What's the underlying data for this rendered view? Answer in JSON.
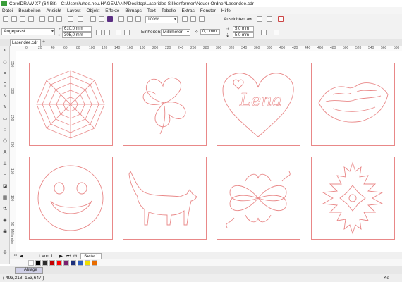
{
  "app": {
    "title": "CorelDRAW X7 (64 Bit) - C:\\Users\\uhde.neu.HAGEMANN\\Desktop\\Laseridee Silikonformen\\Neuer Ordner\\Laseridee.cdr"
  },
  "menu": [
    "Datei",
    "Bearbeiten",
    "Ansicht",
    "Layout",
    "Objekt",
    "Effekte",
    "Bitmaps",
    "Text",
    "Tabelle",
    "Extras",
    "Fenster",
    "Hilfe"
  ],
  "std_toolbar": {
    "zoom": "100%",
    "snap": "Ausrichten an"
  },
  "property_bar": {
    "page_size": "Angepasst",
    "width": "610,0 mm",
    "height": "305,0 mm",
    "units_label": "Einheiten:",
    "units": "Millimeter",
    "nudge": "0,1 mm",
    "dup_x": "5,0 mm",
    "dup_y": "5,0 mm"
  },
  "document_tab": {
    "name": "Laseridee.cdr",
    "add": "+"
  },
  "rulers": {
    "top": [
      "0",
      "20",
      "40",
      "60",
      "80",
      "100",
      "120",
      "140",
      "160",
      "180",
      "200",
      "220",
      "240",
      "260",
      "280",
      "300",
      "320",
      "340",
      "360",
      "380",
      "400",
      "420",
      "440",
      "460",
      "480",
      "500",
      "520",
      "540",
      "560",
      "580",
      "600"
    ],
    "left": [
      "350",
      "300",
      "250",
      "200",
      "150",
      "100",
      "50"
    ],
    "unit_label": "Millimeter"
  },
  "designs": [
    {
      "id": "spider-web"
    },
    {
      "id": "four-leaf-clover"
    },
    {
      "id": "heart-lena",
      "text": "Lena"
    },
    {
      "id": "lips-kiss"
    },
    {
      "id": "smiley"
    },
    {
      "id": "cat"
    },
    {
      "id": "celtic-knot"
    },
    {
      "id": "snowflake"
    }
  ],
  "page_nav": {
    "page_count": "1 von 1",
    "page_tab": "Seite 1"
  },
  "palette": [
    "#ffffff",
    "#000000",
    "#2b2b2b",
    "#c00000",
    "#ff0000",
    "#7a1f6e",
    "#1c2f7a",
    "#2e5fbf",
    "#f0e000",
    "#e86c00"
  ],
  "docker": {
    "tab": "Ablage"
  },
  "status": {
    "coords": "( 493,318; 153,647 )",
    "right": "Ke"
  }
}
